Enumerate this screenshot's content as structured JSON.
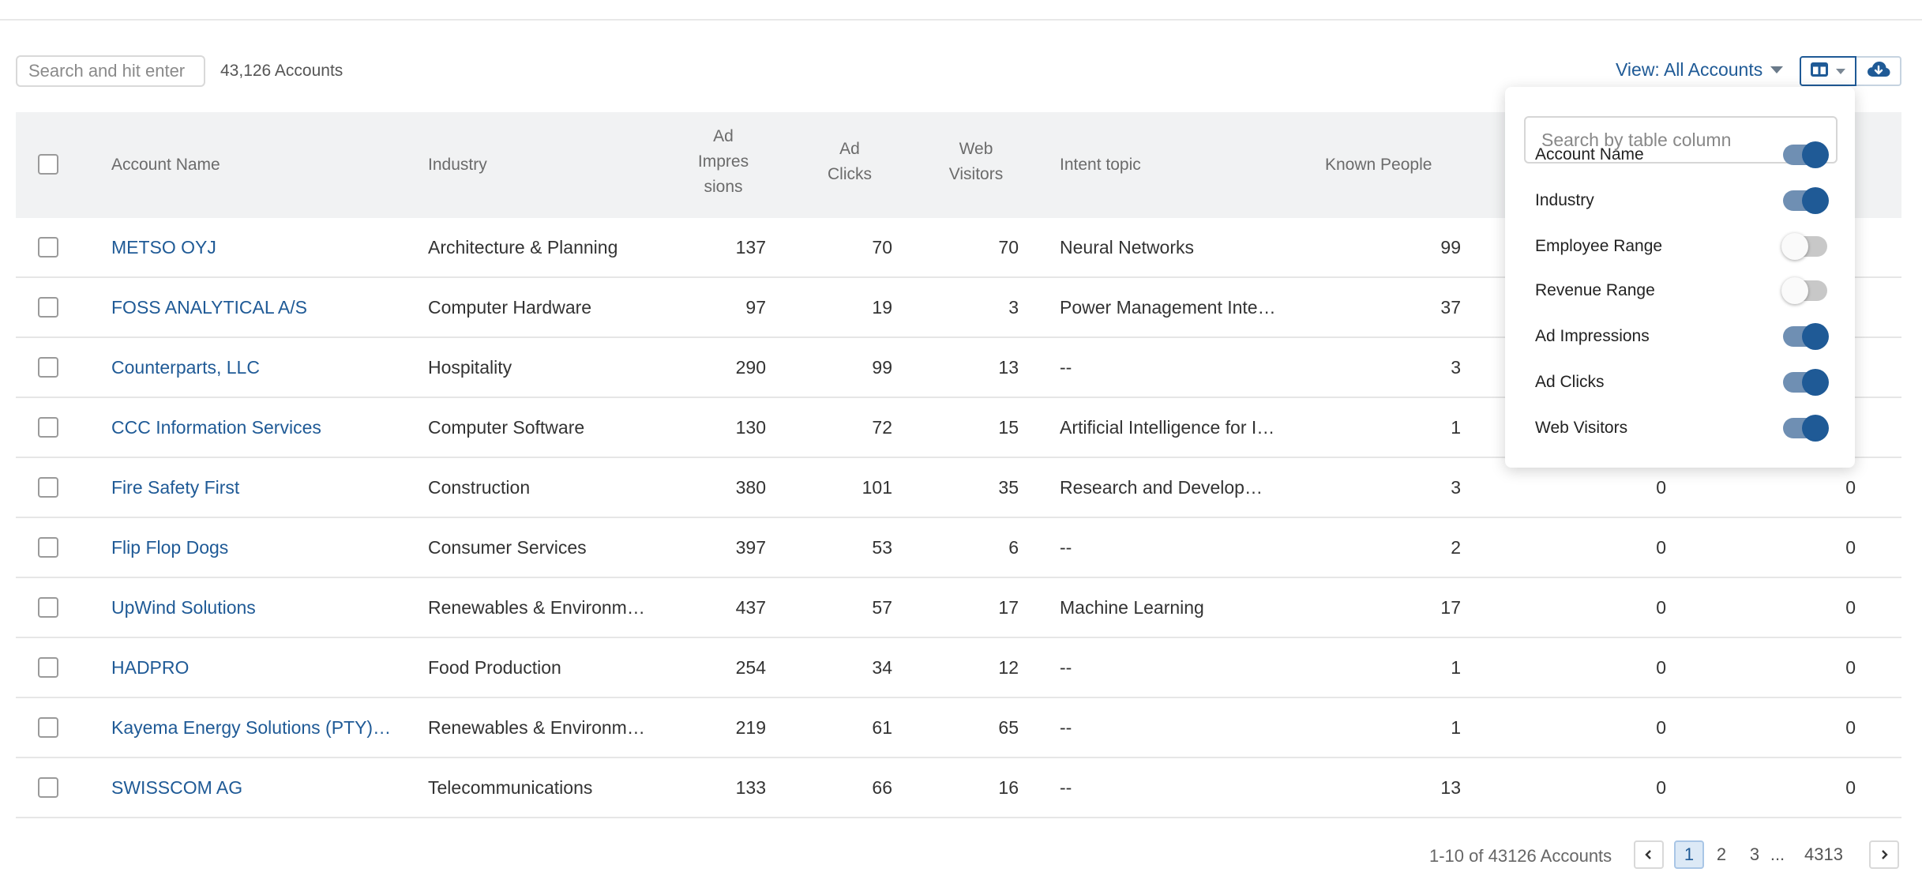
{
  "toolbar": {
    "search_placeholder": "Search and hit enter",
    "account_count": "43,126 Accounts",
    "view_label": "View: All Accounts"
  },
  "table": {
    "headers": {
      "account_name": "Account Name",
      "industry": "Industry",
      "ad_impressions_l1": "Ad",
      "ad_impressions_l2": "Impres",
      "ad_impressions_l3": "sions",
      "ad_clicks_l1": "Ad",
      "ad_clicks_l2": "Clicks",
      "web_visitors_l1": "Web",
      "web_visitors_l2": "Visitors",
      "intent_topic": "Intent topic",
      "known_people": "Known People"
    },
    "rows": [
      {
        "name": "METSO OYJ",
        "industry": "Architecture & Planning",
        "impressions": "137",
        "clicks": "70",
        "visitors": "70",
        "intent": "Neural Networks",
        "known": "99",
        "c8": "",
        "c9": ""
      },
      {
        "name": "FOSS ANALYTICAL A/S",
        "industry": "Computer Hardware",
        "impressions": "97",
        "clicks": "19",
        "visitors": "3",
        "intent": "Power Management Inte…",
        "known": "37",
        "c8": "",
        "c9": ""
      },
      {
        "name": "Counterparts, LLC",
        "industry": "Hospitality",
        "impressions": "290",
        "clicks": "99",
        "visitors": "13",
        "intent": "--",
        "known": "3",
        "c8": "",
        "c9": ""
      },
      {
        "name": "CCC Information Services",
        "industry": "Computer Software",
        "impressions": "130",
        "clicks": "72",
        "visitors": "15",
        "intent": "Artificial Intelligence for I…",
        "known": "1",
        "c8": "",
        "c9": ""
      },
      {
        "name": "Fire Safety First",
        "industry": "Construction",
        "impressions": "380",
        "clicks": "101",
        "visitors": "35",
        "intent": "Research and Develop…",
        "known": "3",
        "c8": "0",
        "c9": "0"
      },
      {
        "name": "Flip Flop Dogs",
        "industry": "Consumer Services",
        "impressions": "397",
        "clicks": "53",
        "visitors": "6",
        "intent": "--",
        "known": "2",
        "c8": "0",
        "c9": "0"
      },
      {
        "name": "UpWind Solutions",
        "industry": "Renewables & Environm…",
        "impressions": "437",
        "clicks": "57",
        "visitors": "17",
        "intent": "Machine Learning",
        "known": "17",
        "c8": "0",
        "c9": "0"
      },
      {
        "name": "HADPRO",
        "industry": "Food Production",
        "impressions": "254",
        "clicks": "34",
        "visitors": "12",
        "intent": "--",
        "known": "1",
        "c8": "0",
        "c9": "0"
      },
      {
        "name": "Kayema Energy Solutions (PTY)…",
        "industry": "Renewables & Environm…",
        "impressions": "219",
        "clicks": "61",
        "visitors": "65",
        "intent": "--",
        "known": "1",
        "c8": "0",
        "c9": "0"
      },
      {
        "name": "SWISSCOM AG",
        "industry": "Telecommunications",
        "impressions": "133",
        "clicks": "66",
        "visitors": "16",
        "intent": "--",
        "known": "13",
        "c8": "0",
        "c9": "0"
      }
    ]
  },
  "column_picker": {
    "search_placeholder": "Search by table column",
    "items": [
      {
        "label": "Account Name",
        "on": true
      },
      {
        "label": "Industry",
        "on": true
      },
      {
        "label": "Employee Range",
        "on": false
      },
      {
        "label": "Revenue Range",
        "on": false
      },
      {
        "label": "Ad Impressions",
        "on": true
      },
      {
        "label": "Ad Clicks",
        "on": true
      },
      {
        "label": "Web Visitors",
        "on": true
      }
    ]
  },
  "pagination": {
    "summary": "1-10 of 43126 Accounts",
    "pages": [
      "1",
      "2",
      "3"
    ],
    "ellipsis": "...",
    "last_page": "4313",
    "current": "1"
  },
  "colors": {
    "accent": "#1f5a96",
    "header_bg": "#f1f2f3"
  },
  "icons": {
    "columns": "columns-icon",
    "download": "cloud-download-icon",
    "prev": "chevron-left-icon",
    "next": "chevron-right-icon"
  }
}
